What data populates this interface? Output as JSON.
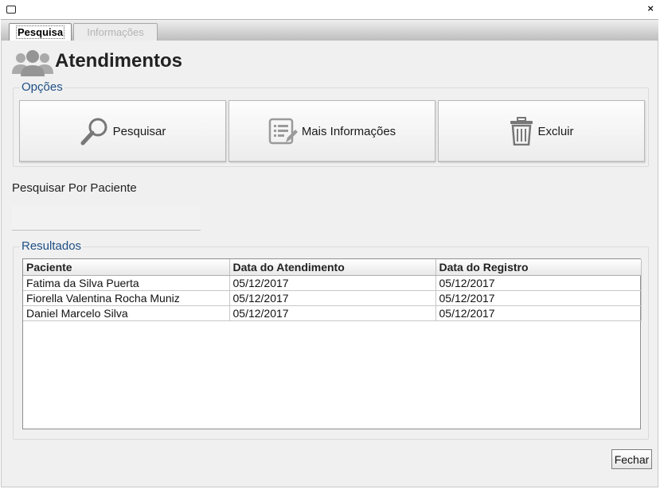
{
  "window": {
    "close_glyph": "×"
  },
  "tabs": [
    {
      "label": "Pesquisa",
      "active": true
    },
    {
      "label": "Informações",
      "active": false
    }
  ],
  "header": {
    "title": "Atendimentos",
    "icon": "users-icon"
  },
  "options": {
    "label": "Opções",
    "buttons": [
      {
        "label": "Pesquisar",
        "icon": "magnifier-icon"
      },
      {
        "label": "Mais Informações",
        "icon": "edit-list-icon"
      },
      {
        "label": "Excluir",
        "icon": "trash-icon"
      }
    ]
  },
  "search": {
    "label": "Pesquisar Por Paciente",
    "value": ""
  },
  "results": {
    "label": "Resultados",
    "columns": [
      "Paciente",
      "Data do Atendimento",
      "Data do Registro"
    ],
    "rows": [
      [
        "Fatima da Silva Puerta",
        "05/12/2017",
        "05/12/2017"
      ],
      [
        "Fiorella Valentina Rocha Muniz",
        "05/12/2017",
        "05/12/2017"
      ],
      [
        "Daniel Marcelo Silva",
        "05/12/2017",
        "05/12/2017"
      ]
    ]
  },
  "footer": {
    "close_label": "Fechar"
  },
  "colors": {
    "accent": "#1e4f86",
    "panel": "#f0f0f0"
  }
}
